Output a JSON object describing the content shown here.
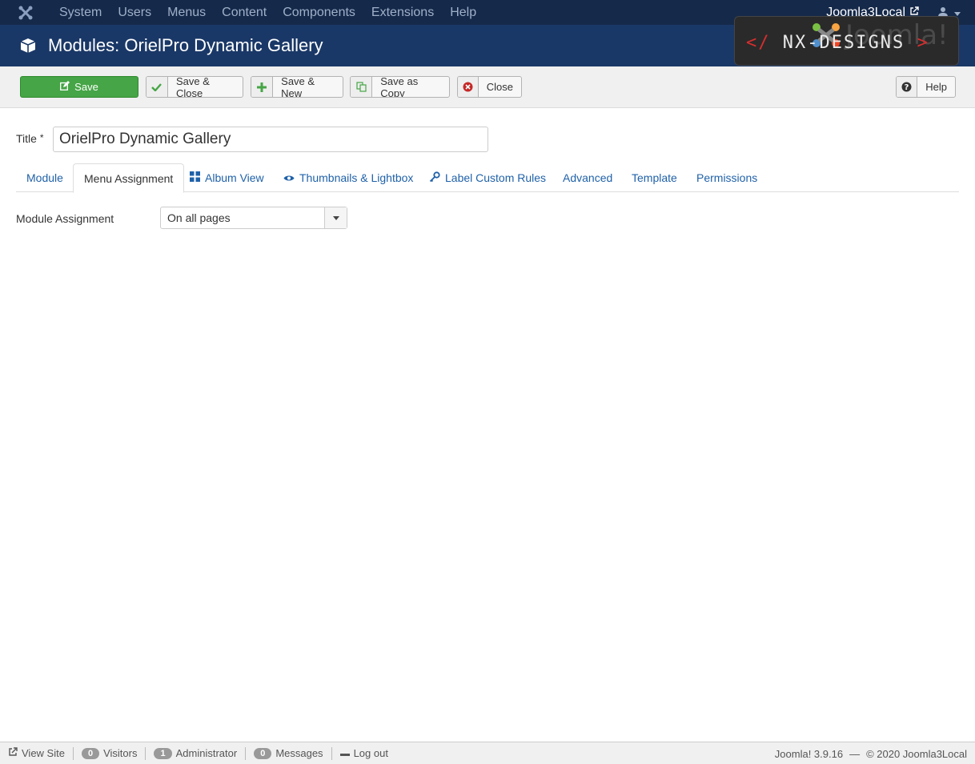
{
  "navbar": {
    "items": [
      "System",
      "Users",
      "Menus",
      "Content",
      "Components",
      "Extensions",
      "Help"
    ],
    "site_name": "Joomla3Local"
  },
  "header": {
    "title": "Modules: OrielPro Dynamic Gallery",
    "brand_joomla": "Joomla!",
    "brand_nx": "NX-DESIGNS"
  },
  "toolbar": {
    "save": "Save",
    "save_close": "Save & Close",
    "save_new": "Save & New",
    "save_copy": "Save as Copy",
    "close": "Close",
    "help": "Help"
  },
  "form": {
    "title_label": "Title",
    "title_required": "*",
    "title_value": "OrielPro Dynamic Gallery"
  },
  "tabs": [
    {
      "label": "Module"
    },
    {
      "label": "Menu Assignment"
    },
    {
      "label": "Album View"
    },
    {
      "label": "Thumbnails & Lightbox"
    },
    {
      "label": "Label Custom Rules"
    },
    {
      "label": "Advanced"
    },
    {
      "label": "Template"
    },
    {
      "label": "Permissions"
    }
  ],
  "assignment": {
    "label": "Module Assignment",
    "value": "On all pages"
  },
  "footer": {
    "view_site": "View Site",
    "visitors_count": "0",
    "visitors_label": "Visitors",
    "admin_count": "1",
    "admin_label": "Administrator",
    "messages_count": "0",
    "messages_label": "Messages",
    "logout": "Log out",
    "version": "Joomla! 3.9.16",
    "dash": "—",
    "copyright": "© 2020 Joomla3Local"
  },
  "colors": {
    "navbar": "#15294a",
    "header": "#1a3867",
    "save_green": "#46a546",
    "link_blue": "#1f61a8"
  }
}
